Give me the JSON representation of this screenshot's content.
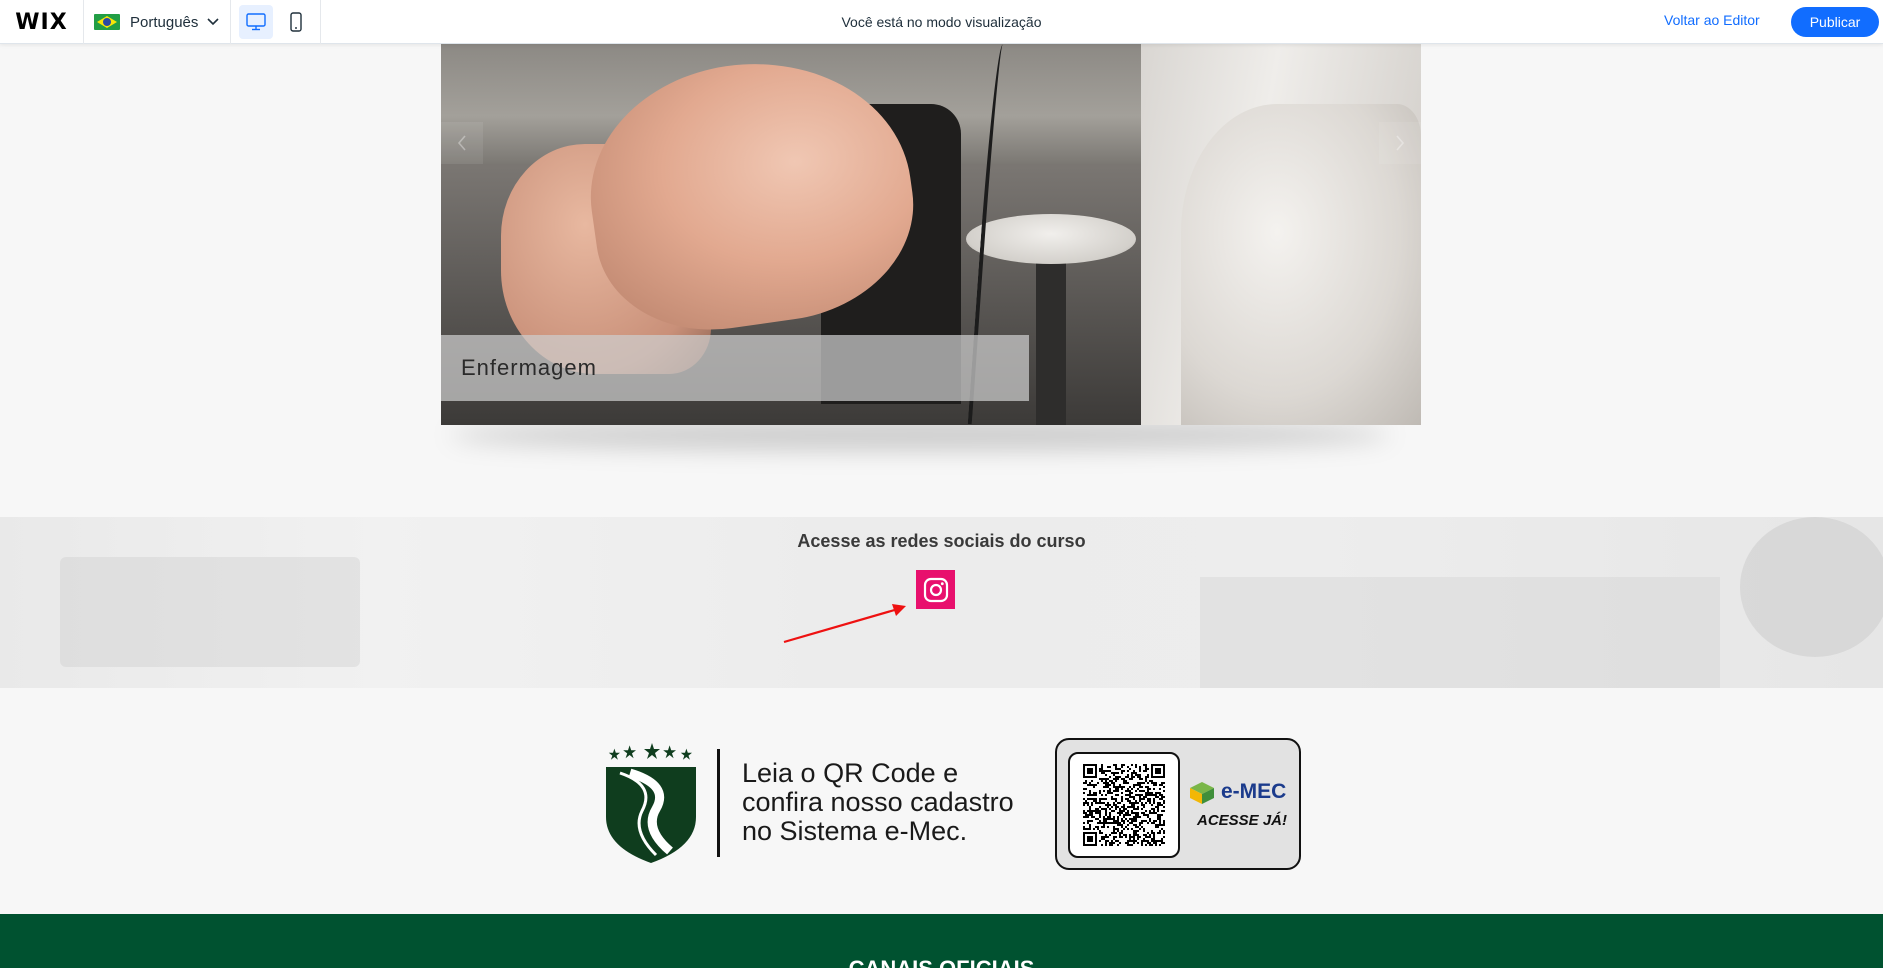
{
  "topbar": {
    "logo": "WIX",
    "language": "Português",
    "preview_notice": "Você está no modo visualização",
    "back_to_editor": "Voltar ao Editor",
    "publish": "Publicar",
    "active_device": "desktop"
  },
  "gallery": {
    "caption": "Enfermagem"
  },
  "social": {
    "title": "Acesse as redes sociais do curso",
    "icons": [
      "instagram-icon"
    ],
    "accent_color": "#e8106d"
  },
  "emec": {
    "lines": [
      "Leia o QR Code e",
      "confira nosso cadastro",
      "no Sistema e-Mec."
    ],
    "logo_label": "e-MEC",
    "cta": "ACESSE JÁ!"
  },
  "footer": {
    "title": "CANAIS OFICIAIS",
    "color": "#005230"
  },
  "colors": {
    "primary_blue": "#116dff",
    "crest_green": "#0f3d1e"
  }
}
